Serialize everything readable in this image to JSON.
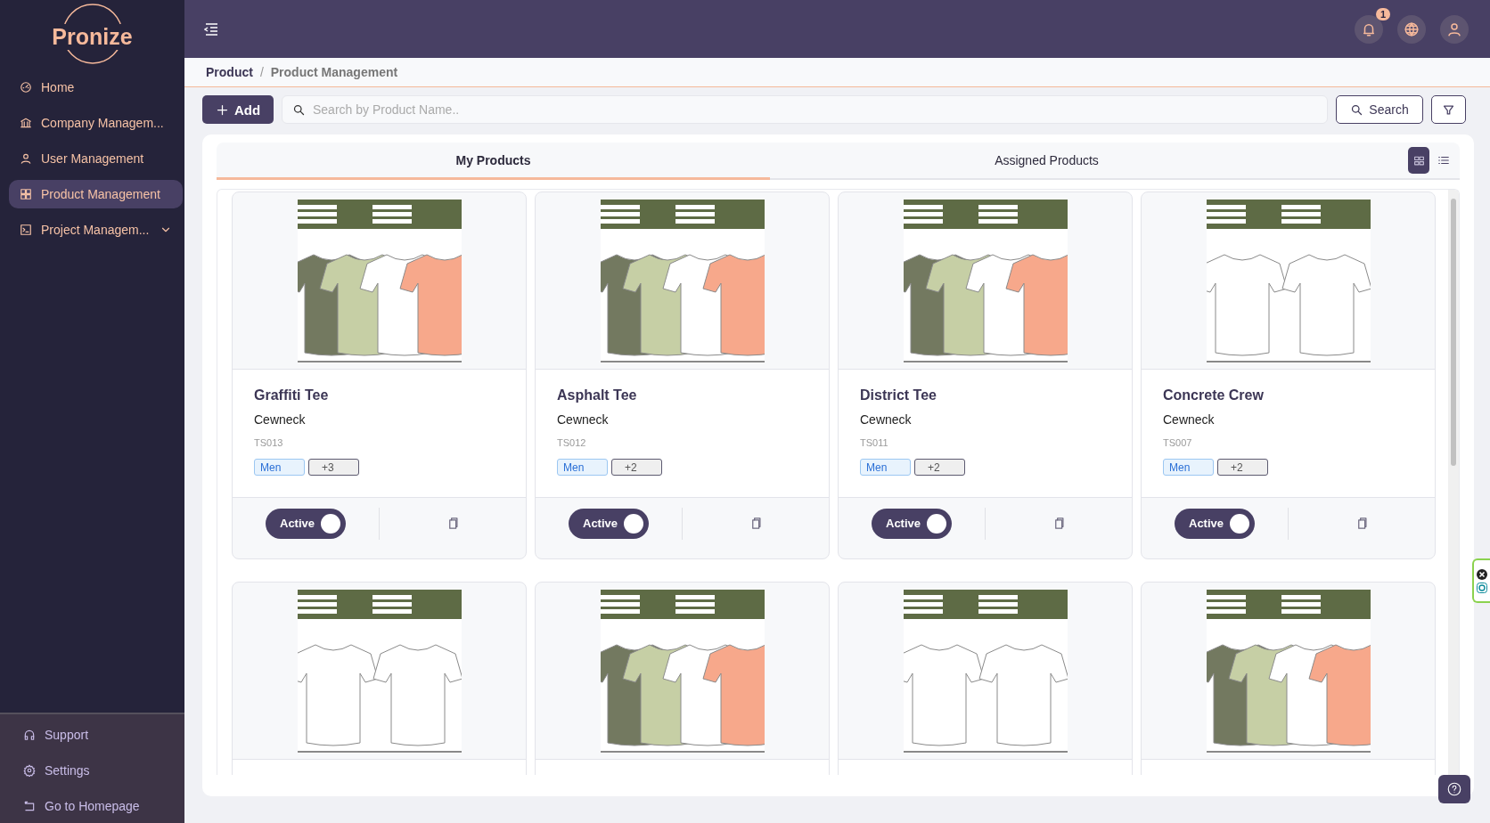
{
  "sidebar": {
    "logo": "Pronize",
    "items": [
      {
        "label": "Home",
        "selected": false
      },
      {
        "label": "Company Managem...",
        "selected": false
      },
      {
        "label": "User Management",
        "selected": false
      },
      {
        "label": "Product Management",
        "selected": true
      },
      {
        "label": "Project Managem...",
        "selected": false,
        "expandable": true
      }
    ],
    "footer": [
      {
        "label": "Support"
      },
      {
        "label": "Settings"
      },
      {
        "label": "Go to Homepage"
      }
    ]
  },
  "topbar": {
    "notifications": "1"
  },
  "breadcrumb": {
    "items": [
      "Product",
      "Product Management"
    ],
    "separator": "/"
  },
  "toolbar": {
    "add": "Add",
    "search": {
      "placeholder": "Search by Product Name.."
    },
    "search_button": "Search"
  },
  "tabs": [
    {
      "label": "My Products",
      "selected": true
    },
    {
      "label": "Assigned Products",
      "selected": false
    }
  ],
  "view": [
    {
      "kind": "grid",
      "selected": true
    },
    {
      "kind": "list",
      "selected": false
    }
  ],
  "products": [
    {
      "image": {
        "kind": "picture"
      },
      "name": "Graffiti Tee",
      "style": "Cewneck",
      "code": "TS013",
      "tags": [
        "Men"
      ],
      "more": "+3",
      "status": "Active",
      "active": true
    },
    {
      "image": {
        "kind": "picture"
      },
      "name": "Asphalt Tee",
      "style": "Cewneck",
      "code": "TS012",
      "tags": [
        "Men"
      ],
      "more": "+2",
      "status": "Active",
      "active": true
    },
    {
      "image": {
        "kind": "picture"
      },
      "name": "District Tee",
      "style": "Cewneck",
      "code": "TS011",
      "tags": [
        "Men"
      ],
      "more": "+2",
      "status": "Active",
      "active": true
    },
    {
      "image": {
        "kind": "picture"
      },
      "name": "Concrete Crew",
      "style": "Cewneck",
      "code": "TS007",
      "tags": [
        "Men"
      ],
      "more": "+2",
      "status": "Active",
      "active": true
    },
    {
      "image": {
        "kind": "picture"
      }
    },
    {
      "image": {
        "kind": "picture"
      }
    },
    {
      "image": {
        "kind": "picture"
      }
    },
    {
      "image": {
        "kind": "picture"
      }
    }
  ]
}
